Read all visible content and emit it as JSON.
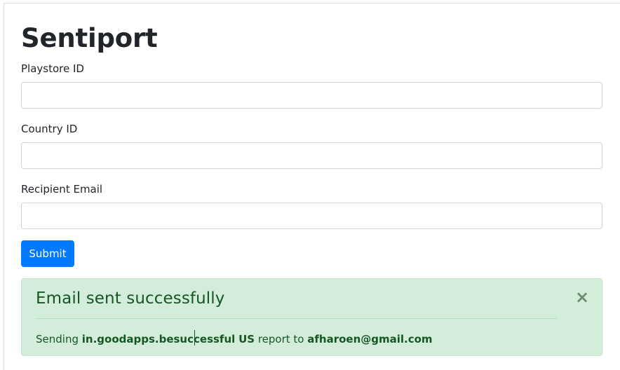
{
  "app": {
    "title": "Sentiport"
  },
  "form": {
    "fields": [
      {
        "label": "Playstore ID",
        "value": "",
        "placeholder": ""
      },
      {
        "label": "Country ID",
        "value": "",
        "placeholder": ""
      },
      {
        "label": "Recipient Email",
        "value": "",
        "placeholder": ""
      }
    ],
    "submit_label": "Submit"
  },
  "alert": {
    "heading": "Email sent successfully",
    "close_symbol": "×",
    "message": {
      "prefix": "Sending",
      "app_id": "in.goodapps.besuccessful",
      "country": "US",
      "middle": "report to",
      "email": "afharoen@gmail.com"
    },
    "colors": {
      "background": "#d4edda",
      "text": "#155724",
      "border": "#c3e6cb"
    }
  },
  "colors": {
    "primary": "#007bff"
  }
}
